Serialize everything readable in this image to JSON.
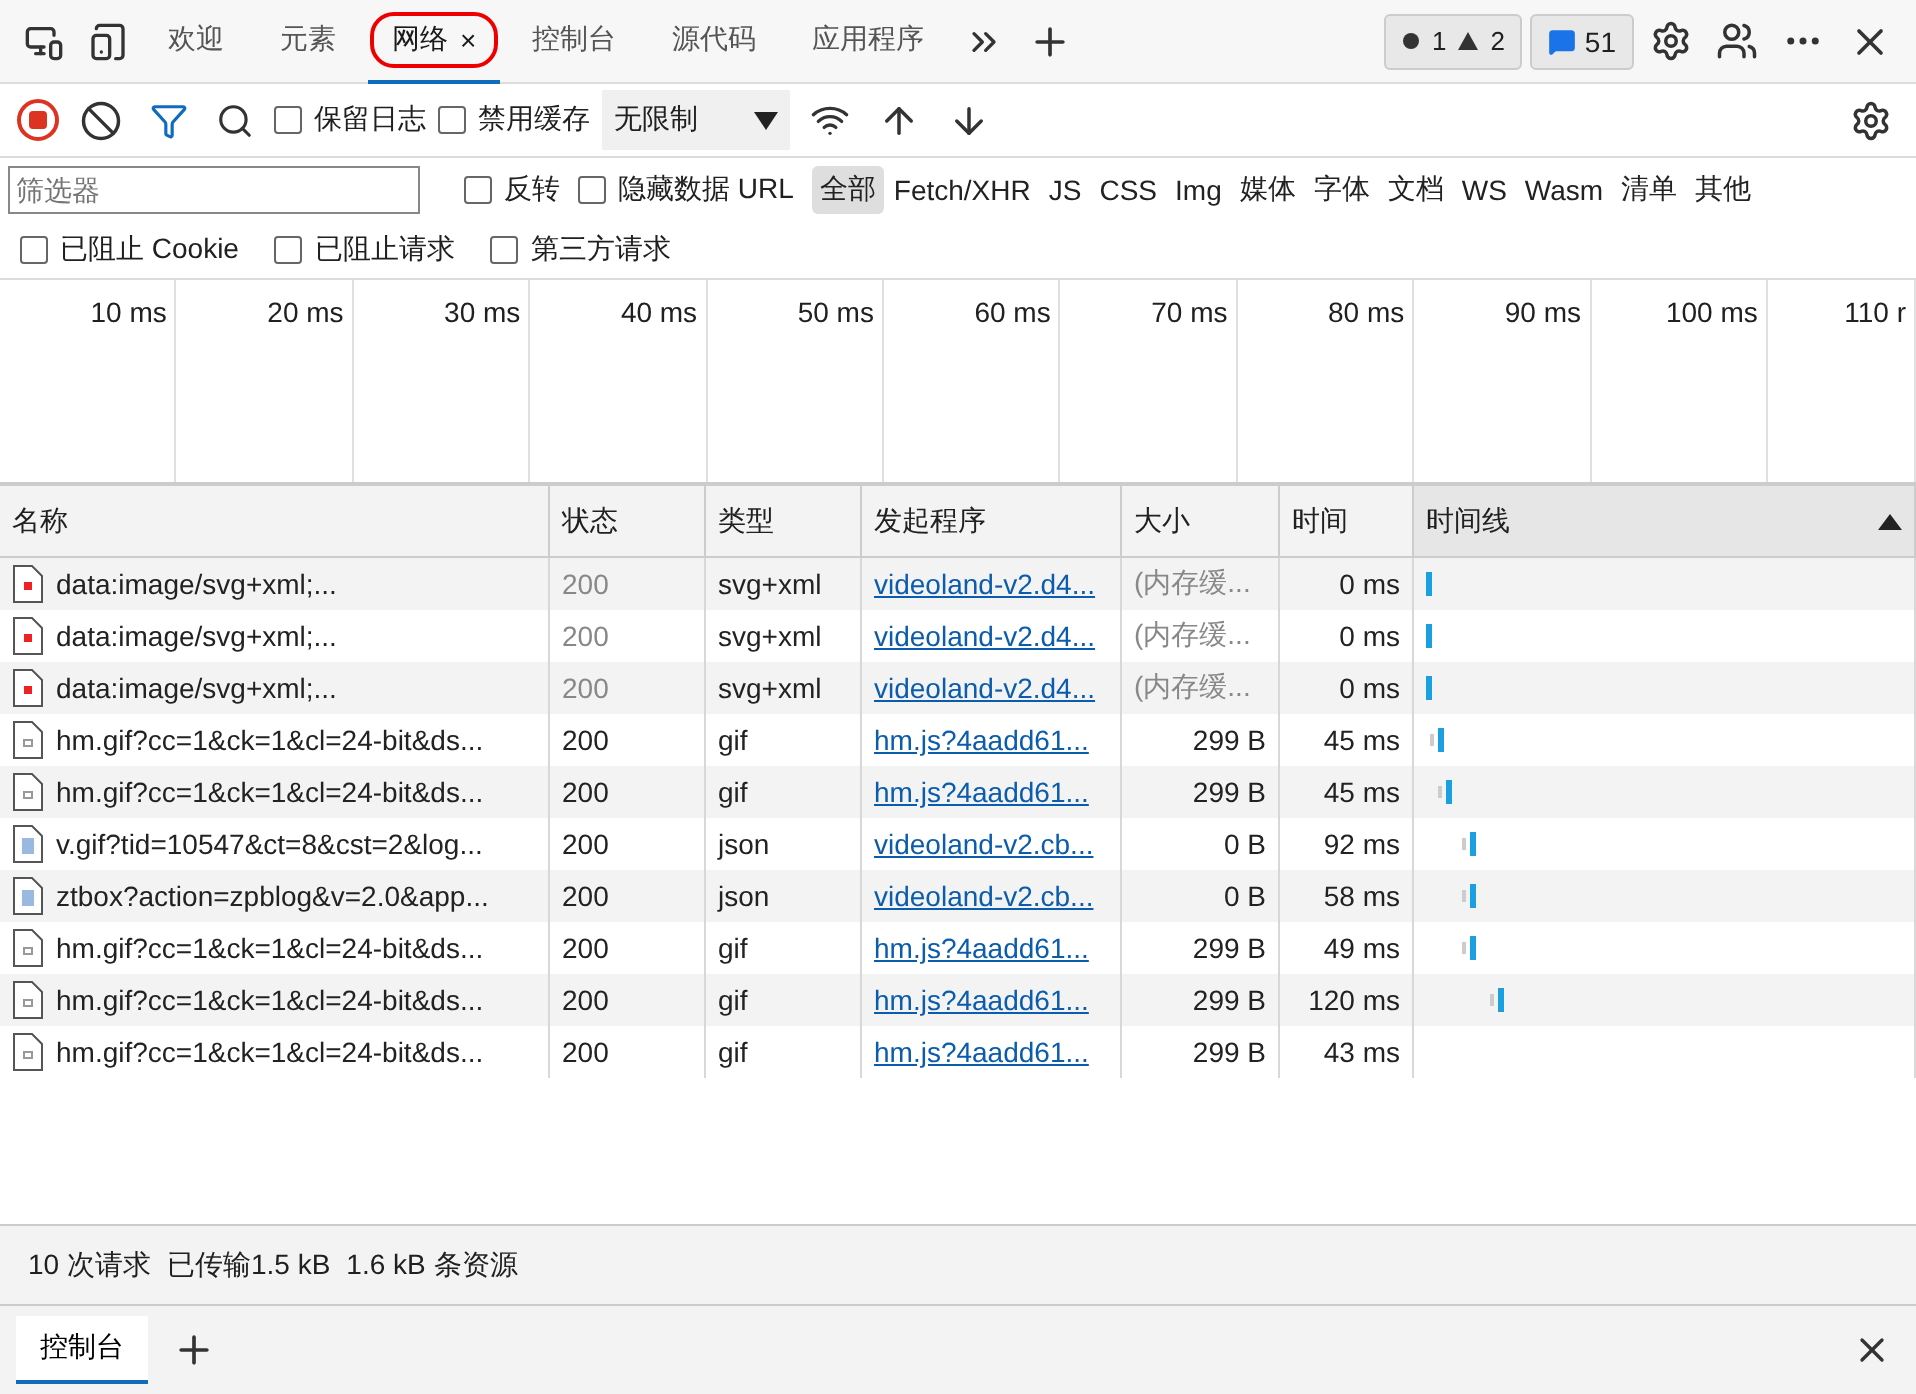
{
  "top_tabs": [
    {
      "label": "欢迎",
      "selected": false,
      "annotated": false
    },
    {
      "label": "元素",
      "selected": false,
      "annotated": false
    },
    {
      "label": "网络",
      "selected": true,
      "annotated": true,
      "close": "×"
    },
    {
      "label": "控制台",
      "selected": false,
      "annotated": false
    },
    {
      "label": "源代码",
      "selected": false,
      "annotated": false
    },
    {
      "label": "应用程序",
      "selected": false,
      "annotated": false
    }
  ],
  "issue_counts": {
    "errors": "1",
    "warnings": "2",
    "messages": "51"
  },
  "toolbar": {
    "recording": true,
    "preserve_log": {
      "label": "保留日志",
      "checked": false
    },
    "disable_cache": {
      "label": "禁用缓存",
      "checked": false
    },
    "throttling": "无限制"
  },
  "filter": {
    "placeholder": "筛选器",
    "invert": {
      "label": "反转",
      "checked": false
    },
    "hide_data_urls": {
      "label": "隐藏数据 URL",
      "checked": false
    },
    "types": [
      {
        "label": "全部",
        "selected": true
      },
      {
        "label": "Fetch/XHR",
        "selected": false
      },
      {
        "label": "JS",
        "selected": false
      },
      {
        "label": "CSS",
        "selected": false
      },
      {
        "label": "Img",
        "selected": false
      },
      {
        "label": "媒体",
        "selected": false
      },
      {
        "label": "字体",
        "selected": false
      },
      {
        "label": "文档",
        "selected": false
      },
      {
        "label": "WS",
        "selected": false
      },
      {
        "label": "Wasm",
        "selected": false
      },
      {
        "label": "清单",
        "selected": false
      },
      {
        "label": "其他",
        "selected": false
      }
    ],
    "extra": [
      {
        "label": "已阻止 Cookie",
        "checked": false
      },
      {
        "label": "已阻止请求",
        "checked": false
      },
      {
        "label": "第三方请求",
        "checked": false
      }
    ]
  },
  "overview_ticks": [
    "10 ms",
    "20 ms",
    "30 ms",
    "40 ms",
    "50 ms",
    "60 ms",
    "70 ms",
    "80 ms",
    "90 ms",
    "100 ms",
    "110 r"
  ],
  "table": {
    "columns": [
      "名称",
      "状态",
      "类型",
      "发起程序",
      "大小",
      "时间",
      "时间线"
    ],
    "rows": [
      {
        "kind": "image",
        "name": "data:image/svg+xml;...",
        "status": "200",
        "type": "svg+xml",
        "initiator": "videoland-v2.d4...",
        "size": "(内存缓...",
        "time": "0 ms",
        "from_cache": true
      },
      {
        "kind": "image",
        "name": "data:image/svg+xml;...",
        "status": "200",
        "type": "svg+xml",
        "initiator": "videoland-v2.d4...",
        "size": "(内存缓...",
        "time": "0 ms",
        "from_cache": true
      },
      {
        "kind": "image",
        "name": "data:image/svg+xml;...",
        "status": "200",
        "type": "svg+xml",
        "initiator": "videoland-v2.d4...",
        "size": "(内存缓...",
        "time": "0 ms",
        "from_cache": true
      },
      {
        "kind": "file",
        "name": "hm.gif?cc=1&ck=1&cl=24-bit&ds...",
        "status": "200",
        "type": "gif",
        "initiator": "hm.js?4aadd61...",
        "size": "299 B",
        "time": "45 ms",
        "from_cache": false
      },
      {
        "kind": "file",
        "name": "hm.gif?cc=1&ck=1&cl=24-bit&ds...",
        "status": "200",
        "type": "gif",
        "initiator": "hm.js?4aadd61...",
        "size": "299 B",
        "time": "45 ms",
        "from_cache": false
      },
      {
        "kind": "data",
        "name": "v.gif?tid=10547&ct=8&cst=2&log...",
        "status": "200",
        "type": "json",
        "initiator": "videoland-v2.cb...",
        "size": "0 B",
        "time": "92 ms",
        "from_cache": false
      },
      {
        "kind": "data",
        "name": "ztbox?action=zpblog&v=2.0&app...",
        "status": "200",
        "type": "json",
        "initiator": "videoland-v2.cb...",
        "size": "0 B",
        "time": "58 ms",
        "from_cache": false
      },
      {
        "kind": "file",
        "name": "hm.gif?cc=1&ck=1&cl=24-bit&ds...",
        "status": "200",
        "type": "gif",
        "initiator": "hm.js?4aadd61...",
        "size": "299 B",
        "time": "49 ms",
        "from_cache": false
      },
      {
        "kind": "file",
        "name": "hm.gif?cc=1&ck=1&cl=24-bit&ds...",
        "status": "200",
        "type": "gif",
        "initiator": "hm.js?4aadd61...",
        "size": "299 B",
        "time": "120 ms",
        "from_cache": false
      },
      {
        "kind": "file",
        "name": "hm.gif?cc=1&ck=1&cl=24-bit&ds...",
        "status": "200",
        "type": "gif",
        "initiator": "hm.js?4aadd61...",
        "size": "299 B",
        "time": "43 ms",
        "from_cache": false
      }
    ]
  },
  "summary": [
    "10 次请求",
    "已传输1.5 kB",
    "1.6 kB 条资源"
  ],
  "drawer_tabs": [
    {
      "label": "控制台",
      "selected": true
    }
  ]
}
